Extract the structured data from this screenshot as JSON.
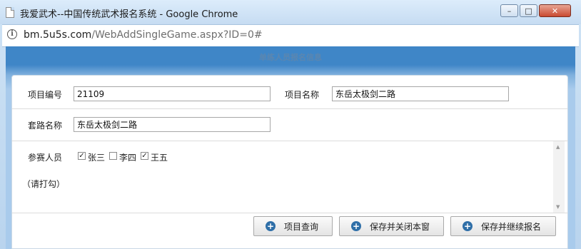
{
  "window": {
    "title": "我爱武术--中国传统武术报名系统 - Google Chrome",
    "minimize_glyph": "–",
    "maximize_glyph": "□",
    "close_glyph": "✕"
  },
  "address": {
    "host": "bm.5u5s.com",
    "path": "/WebAddSingleGame.aspx?ID=0#"
  },
  "page": {
    "header": "单练人员报名信息"
  },
  "form": {
    "project_no_label": "项目编号",
    "project_no_value": "21109",
    "project_name_label": "项目名称",
    "project_name_value": "东岳太极剑二路",
    "routine_label": "套路名称",
    "routine_value": "东岳太极剑二路",
    "participants_label": "参赛人员",
    "participants": [
      {
        "name": "张三",
        "checked": true
      },
      {
        "name": "李四",
        "checked": false
      },
      {
        "name": "王五",
        "checked": true
      }
    ],
    "hint": "（请打勾）"
  },
  "buttons": {
    "query": "项目查询",
    "save_close": "保存并关闭本窗",
    "save_continue": "保存并继续报名"
  },
  "colors": {
    "header_blue": "#3f86c7",
    "icon_blue": "#2f6fa8"
  }
}
